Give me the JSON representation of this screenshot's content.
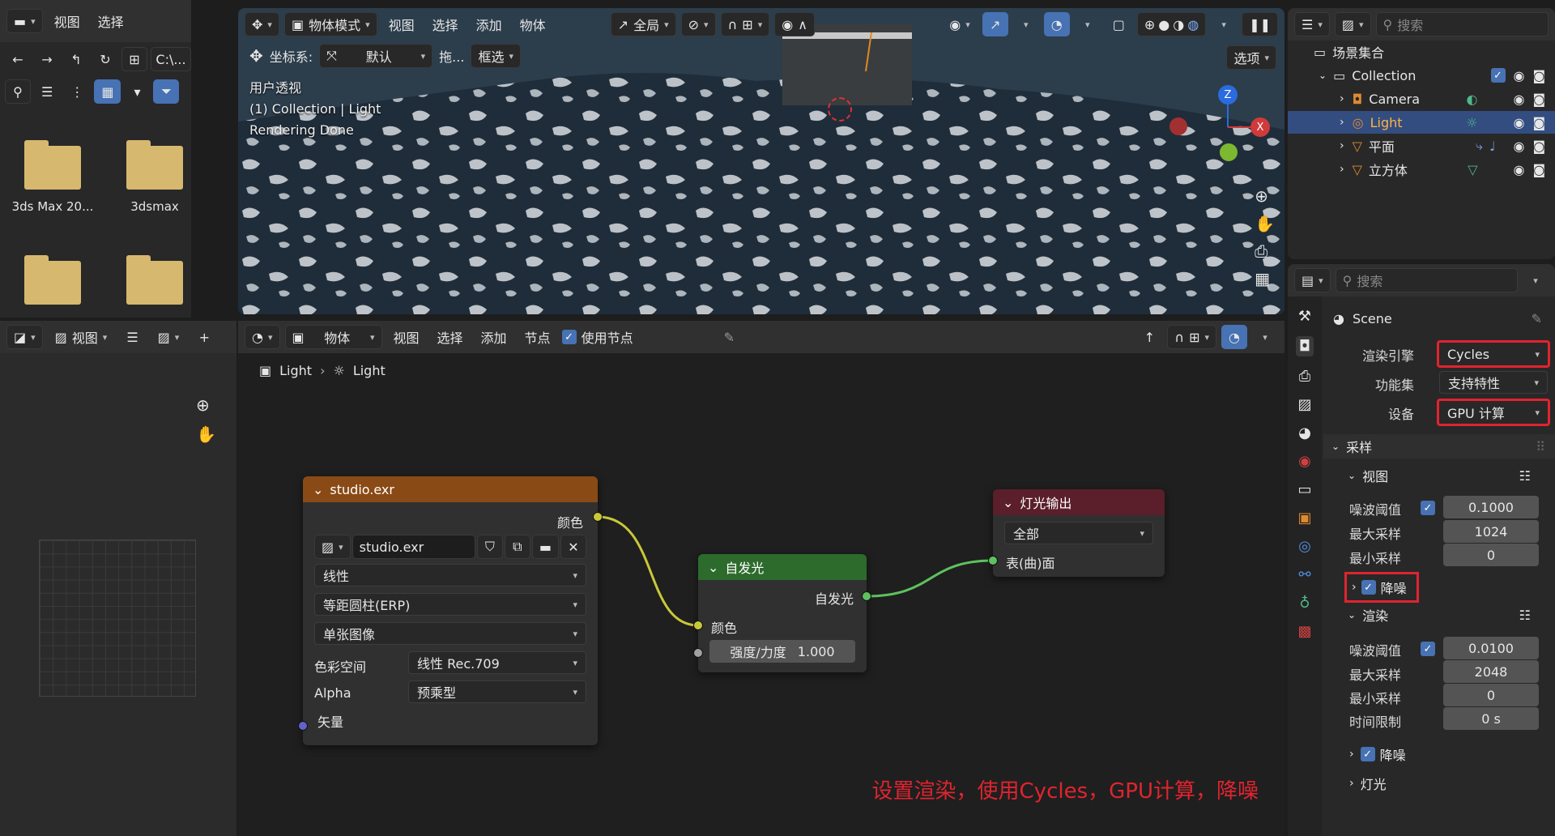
{
  "file_browser": {
    "menus": [
      "视图",
      "选择"
    ],
    "path": "C:\\...",
    "folders": [
      {
        "name": "3ds Max 20..."
      },
      {
        "name": "3dsmax"
      },
      {
        "name": ""
      },
      {
        "name": ""
      }
    ]
  },
  "viewport": {
    "mode": "物体模式",
    "menus": [
      "视图",
      "选择",
      "添加",
      "物体"
    ],
    "transform": "全局",
    "coord_label": "坐标系:",
    "coord_value": "默认",
    "drag_label": "拖...",
    "select_mode": "框选",
    "options": "选项",
    "overlay_lines": [
      "用户透视",
      "(1) Collection | Light",
      "Rendering Done"
    ],
    "gizmo_axes": [
      "Z",
      "X"
    ]
  },
  "image_editor": {
    "view_menu": "视图"
  },
  "node_editor": {
    "mode": "物体",
    "menus": [
      "视图",
      "选择",
      "添加",
      "节点"
    ],
    "use_nodes_label": "使用节点",
    "breadcrumb": [
      "Light",
      "Light"
    ],
    "nodes": {
      "env_texture": {
        "title": "studio.exr",
        "out_color": "颜色",
        "image_name": "studio.exr",
        "interp": "线性",
        "projection": "等距圆柱(ERP)",
        "source": "单张图像",
        "colorspace_label": "色彩空间",
        "colorspace_value": "线性 Rec.709",
        "alpha_label": "Alpha",
        "alpha_value": "预乘型",
        "vector_label": "矢量"
      },
      "emission": {
        "title": "自发光",
        "out_label": "自发光",
        "color_label": "颜色",
        "strength_label": "强度/力度",
        "strength_value": "1.000"
      },
      "light_output": {
        "title": "灯光输出",
        "target": "全部",
        "surface_label": "表(曲)面"
      }
    },
    "annotation": "设置渲染，使用Cycles，GPU计算，降噪"
  },
  "outliner": {
    "search_placeholder": "搜索",
    "scene_collection": "场景集合",
    "items": [
      {
        "name": "Collection"
      },
      {
        "name": "Camera"
      },
      {
        "name": "Light"
      },
      {
        "name": "平面"
      },
      {
        "name": "立方体"
      }
    ]
  },
  "properties": {
    "search_placeholder": "搜索",
    "scene_name": "Scene",
    "render_engine_label": "渲染引擎",
    "render_engine_value": "Cycles",
    "feature_set_label": "功能集",
    "feature_set_value": "支持特性",
    "device_label": "设备",
    "device_value": "GPU 计算",
    "sampling": "采样",
    "viewport_sub": "视图",
    "vp_noise_label": "噪波阈值",
    "vp_noise_value": "0.1000",
    "vp_max_label": "最大采样",
    "vp_max_value": "1024",
    "vp_min_label": "最小采样",
    "vp_min_value": "0",
    "vp_denoise": "降噪",
    "render_sub": "渲染",
    "r_noise_label": "噪波阈值",
    "r_noise_value": "0.0100",
    "r_max_label": "最大采样",
    "r_max_value": "2048",
    "r_min_label": "最小采样",
    "r_min_value": "0",
    "r_time_label": "时间限制",
    "r_time_value": "0 s",
    "r_denoise": "降噪",
    "lights": "灯光"
  },
  "colors": {
    "accent": "#4772b3",
    "highlight_box": "#e0242f",
    "env_node_header": "#8a4a15",
    "emission_header": "#2d6b2d",
    "output_header": "#5a1f2a",
    "yellow_link": "#c8c83a",
    "green_link": "#5ec25e"
  }
}
